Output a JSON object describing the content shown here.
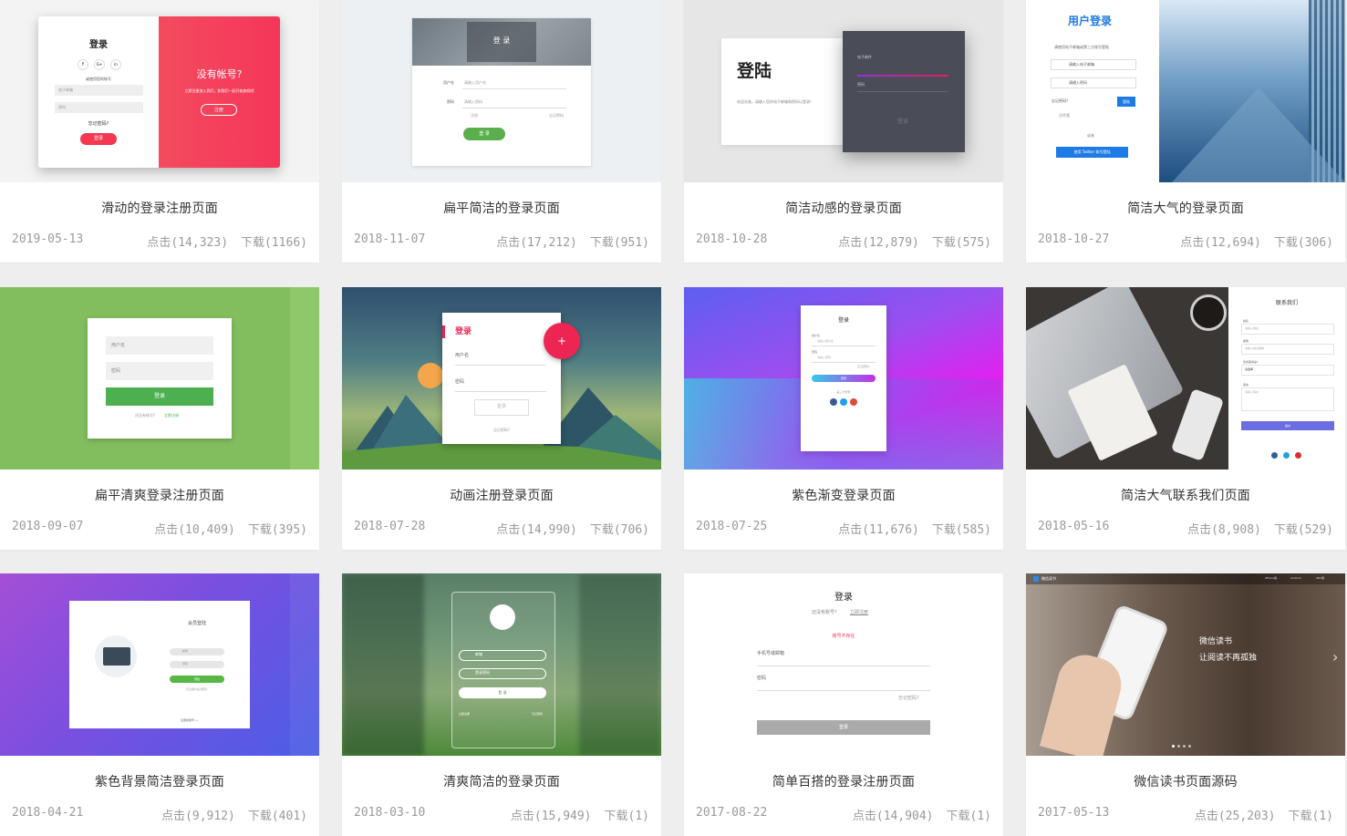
{
  "cards": [
    {
      "title": "滑动的登录注册页面",
      "date": "2019-05-13",
      "views": "点击(14,323)",
      "downloads": "下载(1166)",
      "preview": {
        "heading": "登录",
        "social": [
          "f",
          "G+",
          "in"
        ],
        "hint": "或使用您的帐号",
        "field1": "电子邮箱",
        "field2": "密码",
        "forgot": "忘记密码?",
        "button": "登录",
        "side_title": "没有帐号?",
        "side_text": "立即注册加入我们，和我们一起开始旅程吧",
        "side_button": "注册"
      }
    },
    {
      "title": "扁平简洁的登录页面",
      "date": "2018-11-07",
      "views": "点击(17,212)",
      "downloads": "下载(951)",
      "preview": {
        "heading": "登 录",
        "label1": "用户名",
        "placeholder1": "请输入用户名",
        "label2": "密码",
        "placeholder2": "请输入密码",
        "register": "注册",
        "forgot": "忘记密码",
        "button": "登 录"
      }
    },
    {
      "title": "简洁动感的登录页面",
      "date": "2018-10-28",
      "views": "点击(12,879)",
      "downloads": "下载(575)",
      "preview": {
        "heading": "登陆",
        "text": "欢迎光临，请输入您的电子邮箱和密码以登录!",
        "field1": "电子邮件",
        "field2": "密码",
        "button": "登录"
      }
    },
    {
      "title": "简洁大气的登录页面",
      "date": "2018-10-27",
      "views": "点击(12,694)",
      "downloads": "下载(306)",
      "preview": {
        "heading": "用户登录",
        "subtitle": "请使用电子邮箱或第三方账号登陆",
        "field1": "请输入电子邮箱",
        "field2": "请输入密码",
        "forgot": "忘记密码?",
        "button": "登陆",
        "remember": "记住我",
        "or": "或者",
        "twitter": "使用 Twitter 账号登陆"
      }
    },
    {
      "title": "扁平清爽登录注册页面",
      "date": "2018-09-07",
      "views": "点击(10,409)",
      "downloads": "下载(395)",
      "preview": {
        "field1": "用户名",
        "field2": "密码",
        "button": "登录",
        "hint": "还没有帐号?",
        "link": "立即注册"
      }
    },
    {
      "title": "动画注册登录页面",
      "date": "2018-07-28",
      "views": "点击(14,990)",
      "downloads": "下载(706)",
      "preview": {
        "heading": "登录",
        "field1": "用户名",
        "field2": "密码",
        "button": "登录",
        "forgot": "忘记密码?",
        "plus": "+"
      }
    },
    {
      "title": "紫色渐变登录页面",
      "date": "2018-07-25",
      "views": "点击(11,676)",
      "downloads": "下载(585)",
      "preview": {
        "heading": "登录",
        "label1": "用户名",
        "placeholder1": "请输入用户名",
        "label2": "密码",
        "placeholder2": "请输入密码",
        "forgot": "忘记密码?",
        "button": "登录",
        "other": "第三方登录"
      }
    },
    {
      "title": "简洁大气联系我们页面",
      "date": "2018-05-16",
      "views": "点击(8,908)",
      "downloads": "下载(529)",
      "preview": {
        "heading": "联系我们",
        "label1": "姓名",
        "placeholder1": "请输入姓名",
        "label2": "邮箱",
        "placeholder2": "请输入电子邮箱",
        "label3": "您的需求是?",
        "select": "请选择",
        "label4": "留言",
        "placeholder4": "请输入留言",
        "button": "提交"
      }
    },
    {
      "title": "紫色背景简洁登录页面",
      "date": "2018-04-21",
      "views": "点击(9,912)",
      "downloads": "下载(401)",
      "preview": {
        "heading": "会员登陆",
        "field1": "邮箱",
        "field2": "密码",
        "button": "登陆",
        "forgot": "忘记用户名/密码?",
        "register": "注册新账号 →"
      }
    },
    {
      "title": "清爽简洁的登录页面",
      "date": "2018-03-10",
      "views": "点击(15,949)",
      "downloads": "下载(1)",
      "preview": {
        "field1": "邮箱",
        "field2": "登录密码",
        "button": "登 录",
        "register": "立即注册",
        "forgot": "忘记密码"
      }
    },
    {
      "title": "简单百搭的登录注册页面",
      "date": "2017-08-22",
      "views": "点击(14,904)",
      "downloads": "下载(1)",
      "preview": {
        "heading": "登录",
        "hint": "还没有账号?",
        "link": "立即注册",
        "error": "账号不存在",
        "field1": "手机号或邮箱",
        "field2": "密码",
        "forgot": "忘记密码?",
        "button": "登录"
      }
    },
    {
      "title": "微信读书页面源码",
      "date": "2017-05-13",
      "views": "点击(25,203)",
      "downloads": "下载(1)",
      "preview": {
        "brand": "微信读书",
        "tagline1": "微信读书",
        "tagline2": "让阅读不再孤独",
        "nav1": "iPhone版",
        "nav2": "Android",
        "nav3": "iPad版",
        "arrow": "›"
      }
    }
  ],
  "colors": {
    "red": "#f4384f",
    "green": "#5aaf4c",
    "blue": "#1e7ae6",
    "purple": "#9b39e0"
  }
}
